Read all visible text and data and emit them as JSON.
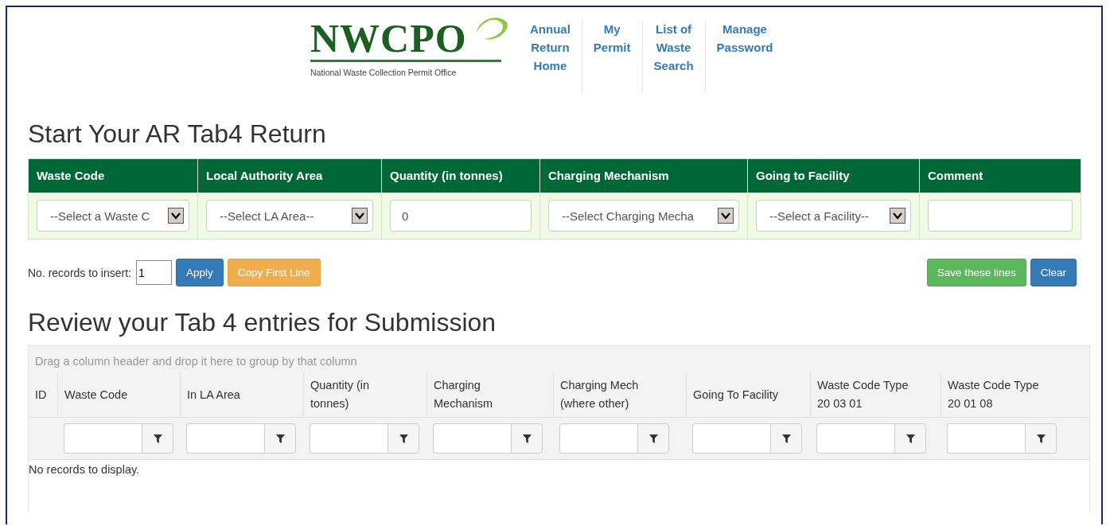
{
  "logo": {
    "wordmark": "NWCPO",
    "tagline": "National Waste Collection Permit Office"
  },
  "nav": [
    {
      "lines": [
        "Annual",
        "Return",
        "Home"
      ]
    },
    {
      "lines": [
        "My",
        "Permit"
      ]
    },
    {
      "lines": [
        "List of",
        "Waste",
        "Search"
      ]
    },
    {
      "lines": [
        "Manage",
        "Password"
      ]
    }
  ],
  "form": {
    "title": "Start Your AR Tab4 Return",
    "columns": [
      {
        "header": "Waste Code",
        "kind": "select",
        "value": "--Select a Waste C"
      },
      {
        "header": "Local Authority Area",
        "kind": "select",
        "value": "--Select LA Area--"
      },
      {
        "header": "Quantity (in tonnes)",
        "kind": "text",
        "value": "0"
      },
      {
        "header": "Charging Mechanism",
        "kind": "select",
        "value": "--Select Charging Mecha"
      },
      {
        "header": "Going to Facility",
        "kind": "select",
        "value": "--Select a Facility--"
      },
      {
        "header": "Comment",
        "kind": "text"
      }
    ],
    "records_label": "No. records to insert:",
    "records_value": "1",
    "left_buttons": [
      {
        "label": "Apply",
        "kind": "primary"
      },
      {
        "label": "Copy First Line",
        "kind": "warning"
      }
    ],
    "right_buttons": [
      {
        "label": "Save these lines",
        "kind": "success"
      },
      {
        "label": "Clear",
        "kind": "primary"
      }
    ]
  },
  "review": {
    "title": "Review your Tab 4 entries for Submission",
    "group_hint": "Drag a column header and drop it here to group by that column",
    "columns": [
      {
        "lines": [
          "ID"
        ],
        "filterable": false
      },
      {
        "lines": [
          "Waste Code"
        ],
        "filterable": true
      },
      {
        "lines": [
          "In LA Area"
        ],
        "filterable": true
      },
      {
        "lines": [
          "Quantity (in",
          "tonnes)"
        ],
        "filterable": true
      },
      {
        "lines": [
          "Charging",
          "Mechanism"
        ],
        "filterable": true
      },
      {
        "lines": [
          "Charging Mech",
          "(where other)"
        ],
        "filterable": true
      },
      {
        "lines": [
          "Going To Facility"
        ],
        "filterable": true
      },
      {
        "lines": [
          "Waste Code Type",
          "20 03 01"
        ],
        "filterable": true
      },
      {
        "lines": [
          "Waste Code Type",
          "20 01 08"
        ],
        "filterable": true
      }
    ],
    "empty_message": "No records to display."
  }
}
